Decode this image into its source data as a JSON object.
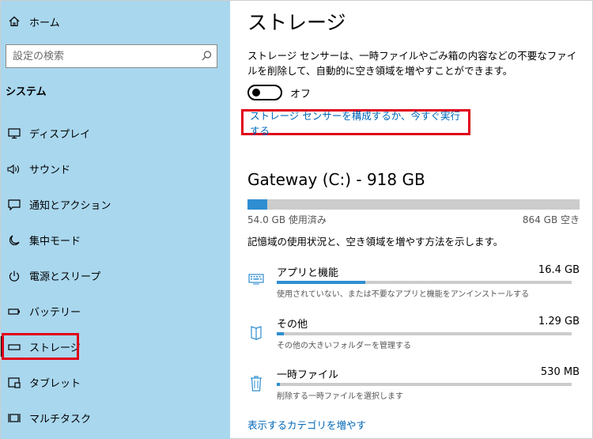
{
  "sidebar": {
    "home_label": "ホーム",
    "search_placeholder": "設定の検索",
    "section_title": "システム",
    "items": [
      {
        "label": "ディスプレイ",
        "icon": "display-icon"
      },
      {
        "label": "サウンド",
        "icon": "speaker-icon"
      },
      {
        "label": "通知とアクション",
        "icon": "notification-icon"
      },
      {
        "label": "集中モード",
        "icon": "moon-icon"
      },
      {
        "label": "電源とスリープ",
        "icon": "power-icon"
      },
      {
        "label": "バッテリー",
        "icon": "battery-icon"
      },
      {
        "label": "ストレージ",
        "icon": "storage-icon",
        "active": true
      },
      {
        "label": "タブレット",
        "icon": "tablet-icon"
      },
      {
        "label": "マルチタスク",
        "icon": "multitask-icon"
      }
    ]
  },
  "main": {
    "title": "ストレージ",
    "description": "ストレージ センサーは、一時ファイルやごみ箱の内容などの不要なファイルを削除して、自動的に空き領域を増やすことができます。",
    "toggle_label": "オフ",
    "sensor_link": "ストレージ センサーを構成するか、今すぐ実行する",
    "drive": {
      "title": "Gateway (C:) - 918 GB",
      "used_label": "54.0 GB 使用済み",
      "free_label": "864 GB 空き",
      "used_fraction": 0.059
    },
    "info_text": "記憶域の使用状況と、空き領域を増やす方法を示します。",
    "categories": [
      {
        "name": "アプリと機能",
        "size": "16.4 GB",
        "sub": "使用されていない、または不要なアプリと機能をアンインストールする",
        "fraction": 0.3,
        "icon": "keyboard-icon"
      },
      {
        "name": "その他",
        "size": "1.29 GB",
        "sub": "その他の大きいフォルダーを管理する",
        "fraction": 0.024,
        "icon": "folder-icon"
      },
      {
        "name": "一時ファイル",
        "size": "530 MB",
        "sub": "削除する一時ファイルを選択します",
        "fraction": 0.012,
        "icon": "trash-icon"
      }
    ],
    "more_link": "表示するカテゴリを増やす"
  },
  "colors": {
    "sidebar_bg": "#a9d7ee",
    "accent": "#2e8ed1",
    "link": "#0067b8",
    "highlight": "#e0001b"
  }
}
